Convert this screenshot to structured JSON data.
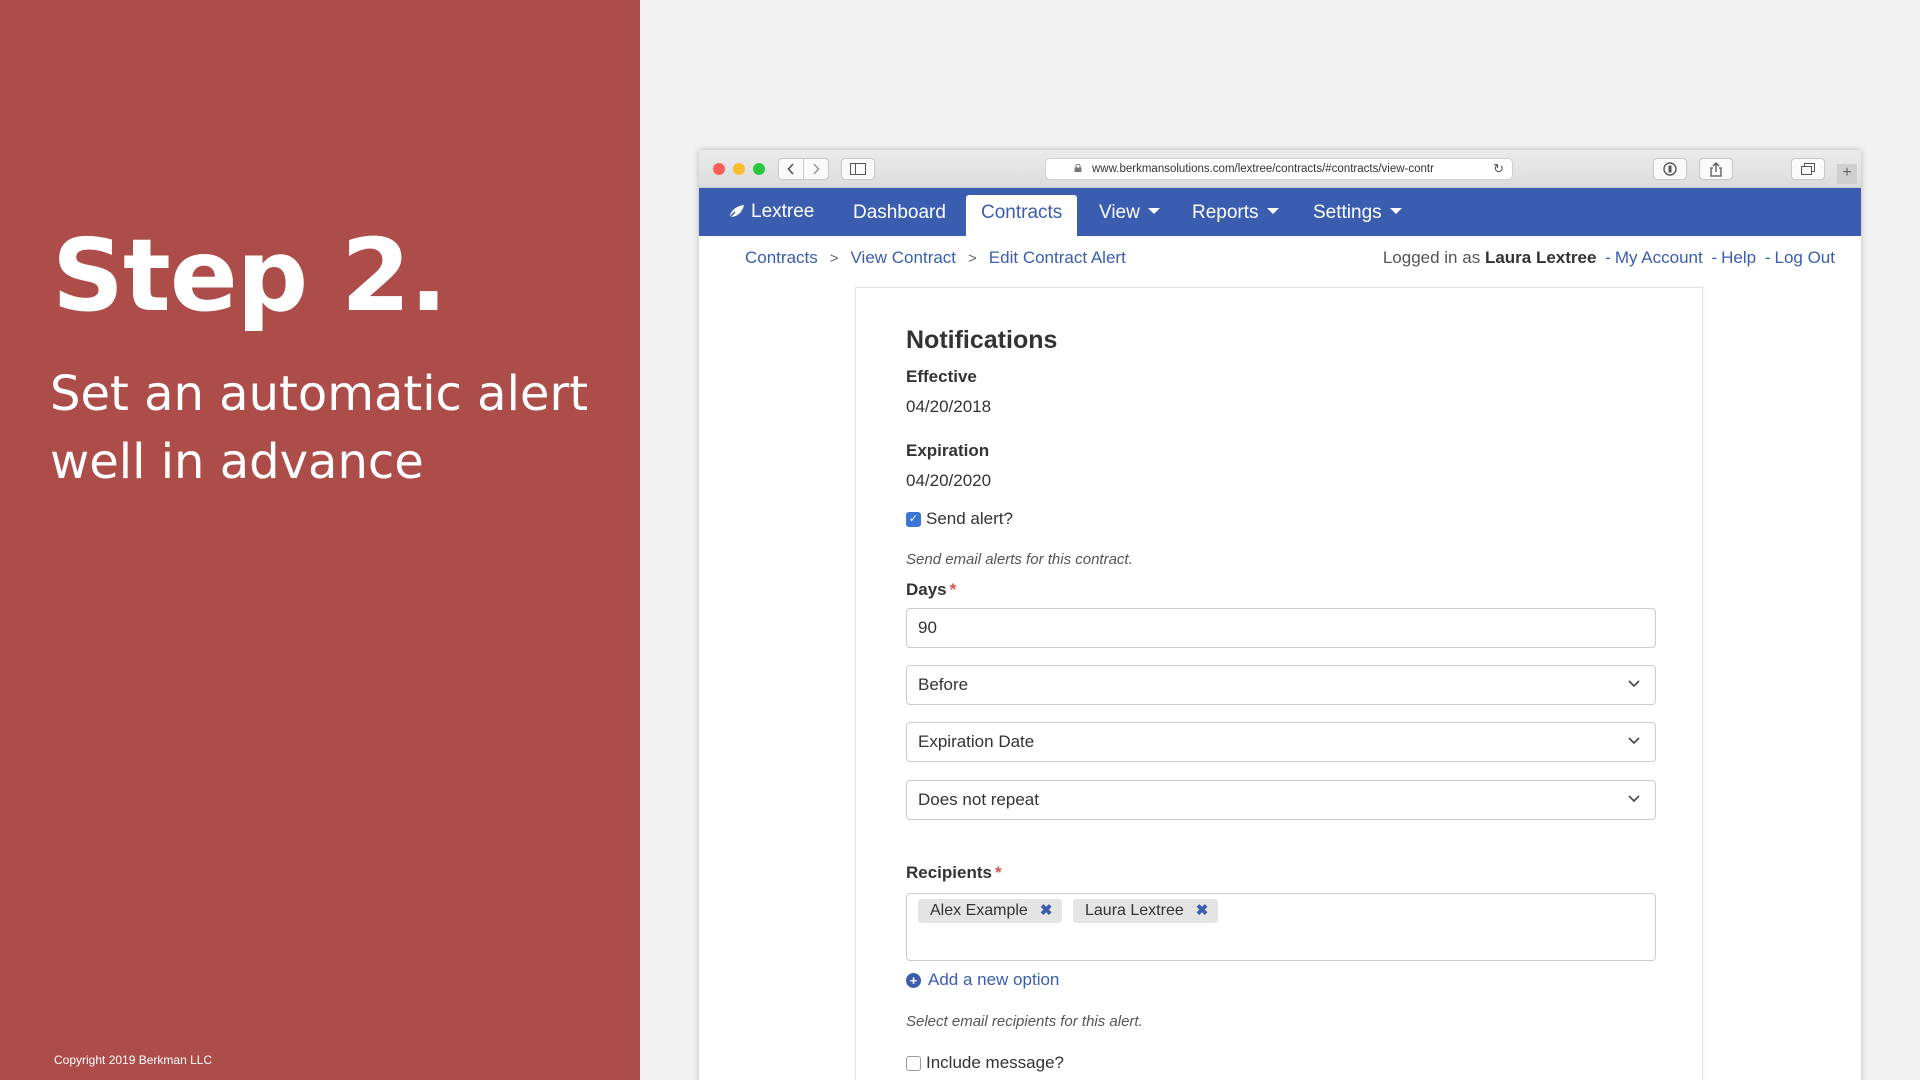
{
  "slide": {
    "title": "Step 2.",
    "subtitle": "Set an automatic alert well in advance",
    "copyright": "Copyright 2019 Berkman LLC"
  },
  "browser": {
    "url": "www.berkmansolutions.com/lextree/contracts/#contracts/view-contr"
  },
  "nav": {
    "brand": "Lextree",
    "dashboard": "Dashboard",
    "contracts": "Contracts",
    "view": "View",
    "reports": "Reports",
    "settings": "Settings"
  },
  "breadcrumb": {
    "items": [
      "Contracts",
      "View Contract",
      "Edit Contract Alert"
    ]
  },
  "user": {
    "logged_in_prefix": "Logged in as",
    "name": "Laura Lextree",
    "my_account": "My Account",
    "help": "Help",
    "logout": "Log Out",
    "separator": "-"
  },
  "form": {
    "title": "Notifications",
    "effective_label": "Effective",
    "effective_value": "04/20/2018",
    "expiration_label": "Expiration",
    "expiration_value": "04/20/2020",
    "send_alert_label": "Send alert?",
    "send_alert_checked": true,
    "send_alert_help": "Send email alerts for this contract.",
    "days_label": "Days",
    "days_value": "90",
    "timing_value": "Before",
    "date_field_value": "Expiration Date",
    "repeat_value": "Does not repeat",
    "recipients_label": "Recipients",
    "recipients": [
      "Alex Example",
      "Laura Lextree"
    ],
    "add_option": "Add a new option",
    "recipients_help": "Select email recipients for this alert.",
    "include_message_label": "Include message?",
    "include_message_checked": false,
    "required_marker": "*"
  },
  "colors": {
    "slide_bg": "#ad4d49",
    "navbar": "#3a5daf",
    "link": "#3a5daf",
    "required": "#d9534f"
  }
}
